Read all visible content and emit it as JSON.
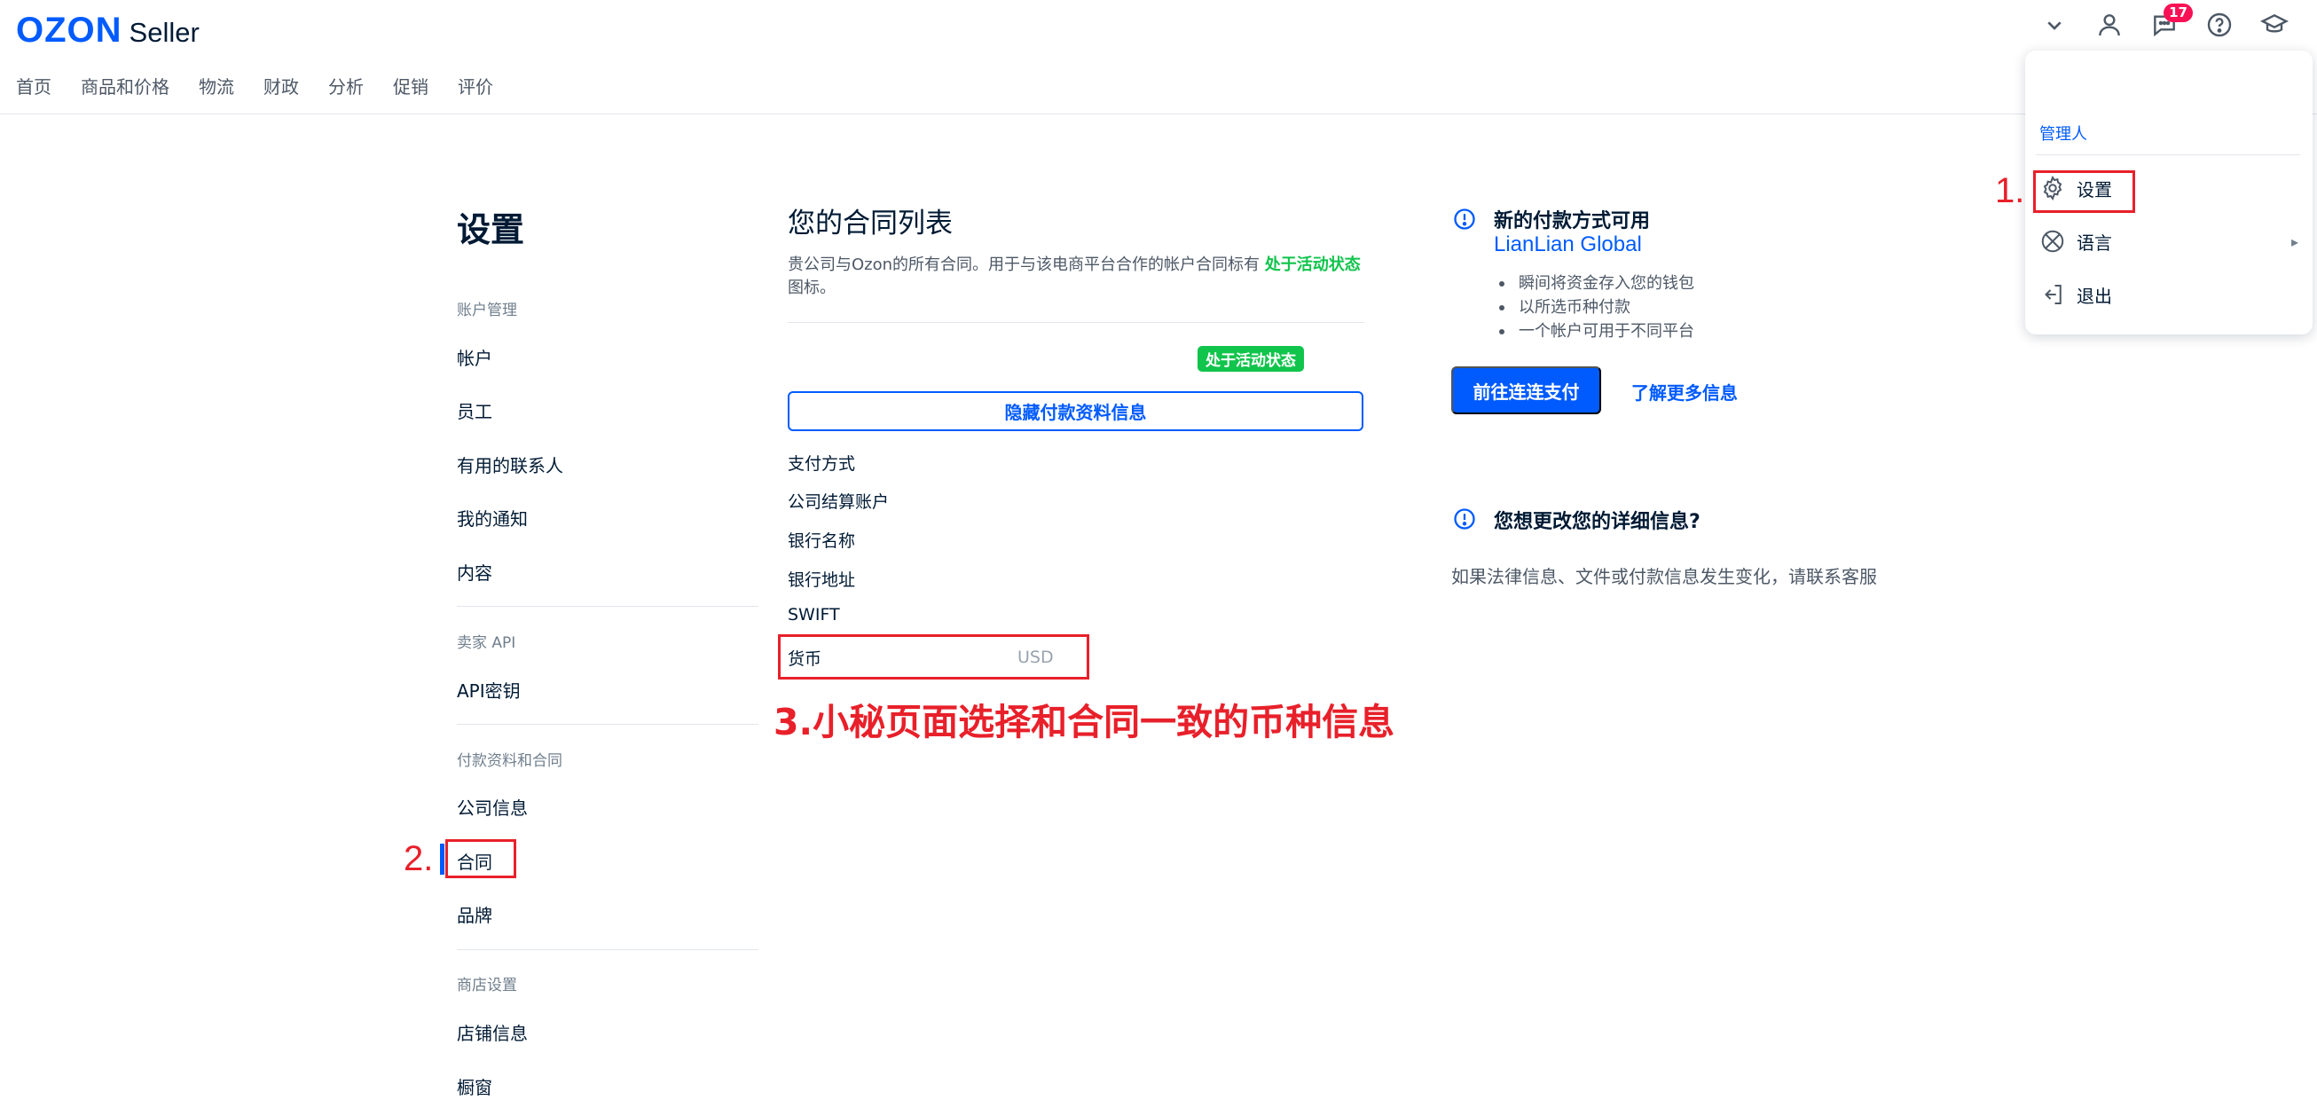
{
  "header": {
    "logo_brand": "OZON",
    "logo_product": "Seller",
    "notification_count": "17",
    "icons": [
      "chevron-down-icon",
      "user-icon",
      "chat-icon",
      "help-icon",
      "graduation-cap-icon"
    ]
  },
  "nav": {
    "items": [
      "首页",
      "商品和价格",
      "物流",
      "财政",
      "分析",
      "促销",
      "评价"
    ]
  },
  "settings": {
    "title": "设置",
    "sections": [
      {
        "label": "账户管理",
        "items": [
          "帐户",
          "员工",
          "有用的联系人",
          "我的通知",
          "内容"
        ]
      },
      {
        "label": "卖家 API",
        "items": [
          "API密钥"
        ]
      },
      {
        "label": "付款资料和合同",
        "items": [
          "公司信息",
          "合同",
          "品牌"
        ]
      },
      {
        "label": "商店设置",
        "items": [
          "店铺信息",
          "橱窗"
        ]
      }
    ],
    "active_item": "合同"
  },
  "contracts": {
    "title": "您的合同列表",
    "description_prefix": "贵公司与Ozon的所有合同。用于与该电商平台合作的帐户合同标有",
    "description_highlight": "处于活动状态",
    "description_suffix": "图标。",
    "status_badge": "处于活动状态",
    "hide_button": "隐藏付款资料信息",
    "fields": [
      {
        "label": "支付方式",
        "value": ""
      },
      {
        "label": "公司结算账户",
        "value": ""
      },
      {
        "label": "银行名称",
        "value": ""
      },
      {
        "label": "银行地址",
        "value": ""
      },
      {
        "label": "SWIFT",
        "value": ""
      },
      {
        "label": "货币",
        "value": "USD"
      }
    ]
  },
  "info": {
    "new_payment_title": "新的付款方式可用",
    "provider": "LianLian Global",
    "bullets": [
      "瞬间将资金存入您的钱包",
      "以所选币种付款",
      "一个帐户可用于不同平台"
    ],
    "pay_button": "前往连连支付",
    "learn_more": "了解更多信息",
    "change_title": "您想更改您的详细信息?",
    "change_desc": "如果法律信息、文件或付款信息发生变化，请联系客服"
  },
  "dropdown": {
    "role": "管理人",
    "items": [
      {
        "label": "设置",
        "icon": "gear-icon"
      },
      {
        "label": "语言",
        "icon": "globe-icon"
      },
      {
        "label": "退出",
        "icon": "logout-icon"
      }
    ]
  },
  "annotations": {
    "step1": "1.",
    "step2": "2.",
    "step3": "3.小秘页面选择和合同一致的币种信息",
    "color": "#e8202a"
  },
  "colors": {
    "brand": "#005bff",
    "active_green": "#10c44c",
    "badge_red": "#f91155"
  }
}
